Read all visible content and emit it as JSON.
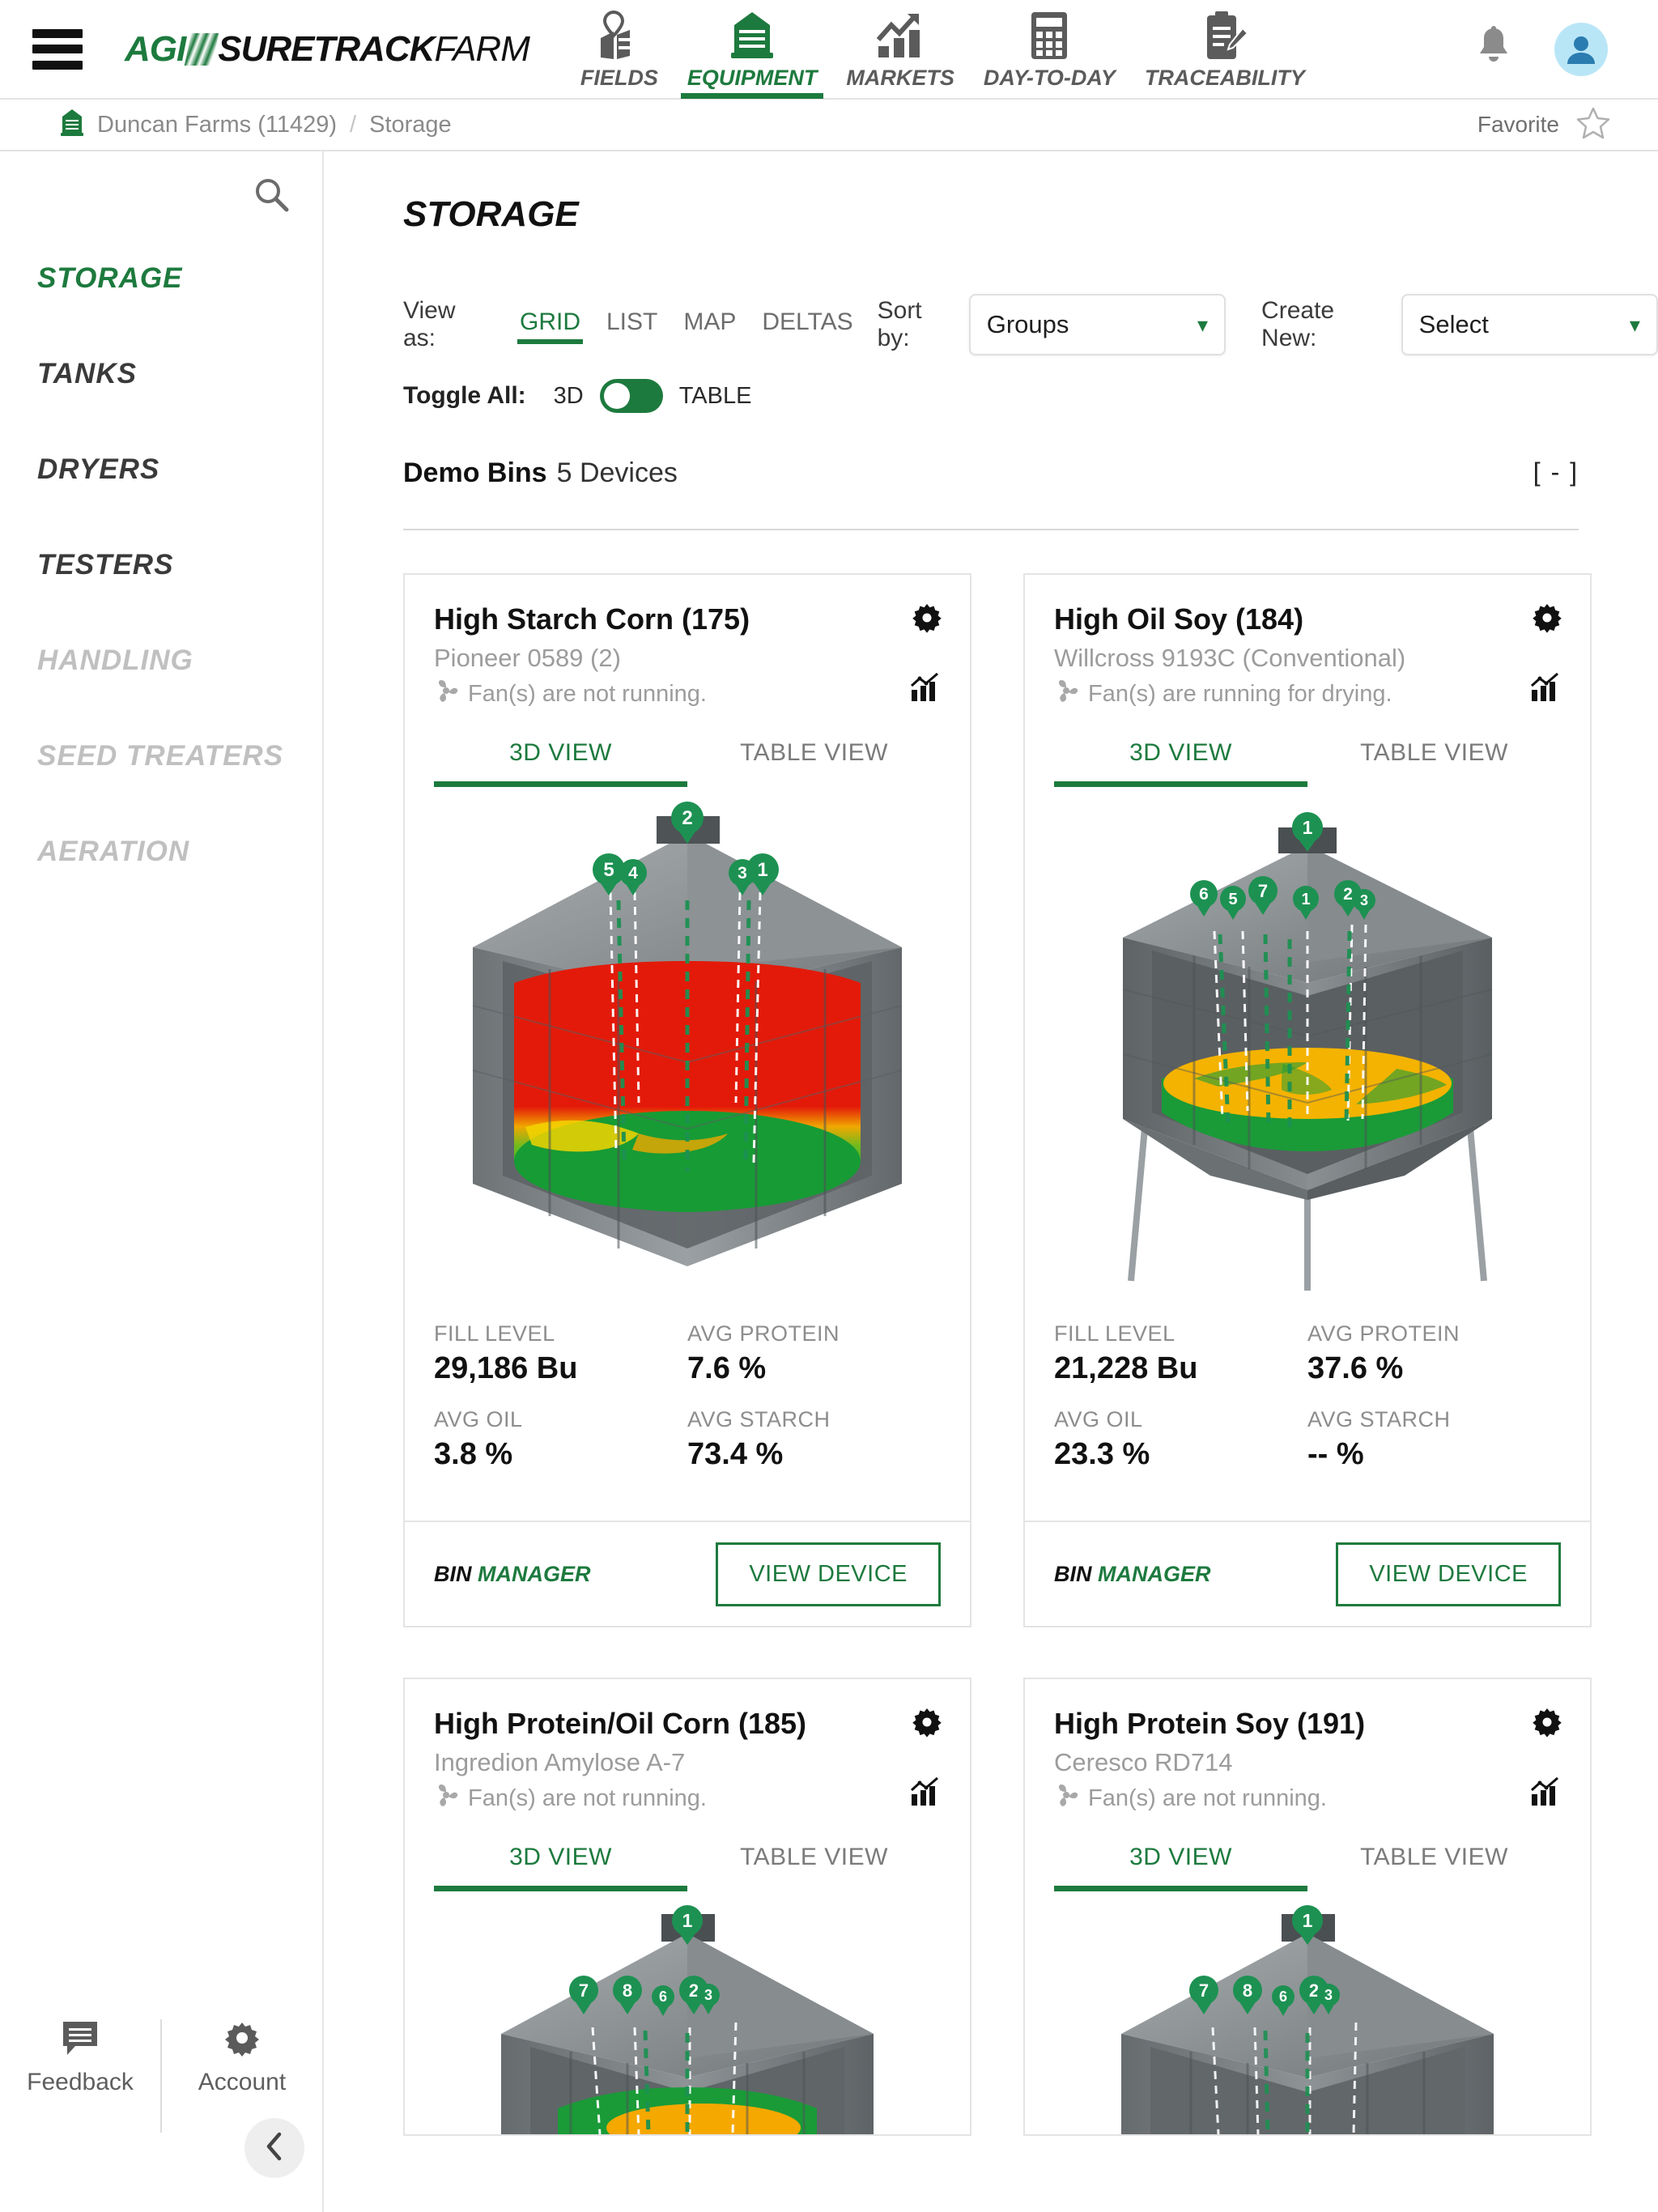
{
  "header": {
    "menu_icon": "hamburger-menu-icon",
    "brand": {
      "agi": "AGI",
      "sure": "SURETRACK",
      "farm": "FARM"
    },
    "nav": [
      {
        "label": "FIELDS",
        "icon": "map-pin-field-icon",
        "active": false
      },
      {
        "label": "EQUIPMENT",
        "icon": "grain-bin-icon",
        "active": true
      },
      {
        "label": "MARKETS",
        "icon": "bar-chart-trend-icon",
        "active": false
      },
      {
        "label": "DAY-TO-DAY",
        "icon": "calculator-icon",
        "active": false
      },
      {
        "label": "TRACEABILITY",
        "icon": "clipboard-pencil-icon",
        "active": false
      }
    ],
    "bell_icon": "notification-bell-icon",
    "avatar_icon": "user-avatar-icon"
  },
  "breadcrumb": {
    "farm_icon": "grain-bin-icon",
    "farm": "Duncan Farms (11429)",
    "separator": "/",
    "current": "Storage",
    "favorite_label": "Favorite",
    "favorite_icon": "star-outline-icon"
  },
  "sidebar": {
    "search_icon": "search-icon",
    "items": [
      {
        "label": "STORAGE",
        "state": "active"
      },
      {
        "label": "TANKS",
        "state": "normal"
      },
      {
        "label": "DRYERS",
        "state": "normal"
      },
      {
        "label": "TESTERS",
        "state": "normal"
      },
      {
        "label": "HANDLING",
        "state": "muted"
      },
      {
        "label": "SEED TREATERS",
        "state": "muted"
      },
      {
        "label": "AERATION",
        "state": "muted"
      }
    ],
    "footer": {
      "feedback_label": "Feedback",
      "feedback_icon": "comment-icon",
      "account_label": "Account",
      "account_icon": "gear-icon",
      "collapse_icon": "chevron-left-icon"
    }
  },
  "main": {
    "page_title": "STORAGE",
    "toolbar": {
      "view_as_label": "View as:",
      "view_options": [
        {
          "label": "GRID",
          "active": true
        },
        {
          "label": "LIST",
          "active": false
        },
        {
          "label": "MAP",
          "active": false
        },
        {
          "label": "DELTAS",
          "active": false
        }
      ],
      "sort_by_label": "Sort by:",
      "sort_by_value": "Groups",
      "create_new_label": "Create New:",
      "create_new_value": "Select",
      "chevron_icon": "chevron-down-icon"
    },
    "toggle_all": {
      "label": "Toggle All:",
      "left_option": "3D",
      "right_option": "TABLE",
      "state": "3D"
    },
    "group": {
      "name": "Demo Bins",
      "count": "5 Devices",
      "collapse_toggle": "[ - ]"
    },
    "tab_3d_label": "3D VIEW",
    "tab_table_label": "TABLE VIEW",
    "gear_icon": "gear-icon",
    "chart_icon": "bar-chart-icon",
    "fan_icon": "fan-icon",
    "bin_manager_bold": "BIN",
    "bin_manager_rest": " MANAGER",
    "view_device_label": "VIEW DEVICE",
    "stat_labels": {
      "fill_level": "FILL LEVEL",
      "avg_protein": "AVG PROTEIN",
      "avg_oil": "AVG OIL",
      "avg_starch": "AVG STARCH"
    },
    "cards": [
      {
        "title": "High Starch Corn (175)",
        "subtitle": "Pioneer 0589 (2)",
        "fan_status": "Fan(s) are not running.",
        "fill_level": "29,186 Bu",
        "avg_protein": "7.6 %",
        "avg_oil": "3.8 %",
        "avg_starch": "73.4 %",
        "bin_type": "hopper-flat",
        "fill_fraction": 0.78,
        "sensor_markers": [
          "5",
          "4",
          "2",
          "3",
          "1"
        ],
        "grain_colors": [
          "#e21b0c",
          "#f0a000",
          "#1ea33c"
        ]
      },
      {
        "title": "High Oil Soy (184)",
        "subtitle": "Willcross 9193C (Conventional)",
        "fan_status": "Fan(s) are running for drying.",
        "fill_level": "21,228 Bu",
        "avg_protein": "37.6 %",
        "avg_oil": "23.3 %",
        "avg_starch": "-- %",
        "bin_type": "legged-hopper",
        "fill_fraction": 0.35,
        "sensor_markers": [
          "6",
          "5",
          "7",
          "1",
          "1",
          "2",
          "3"
        ],
        "grain_colors": [
          "#f0b400",
          "#1ea33c"
        ]
      },
      {
        "title": "High Protein/Oil Corn (185)",
        "subtitle": "Ingredion Amylose A-7",
        "fan_status": "Fan(s) are not running.",
        "fill_level": "",
        "avg_protein": "",
        "avg_oil": "",
        "avg_starch": "",
        "bin_type": "flat",
        "fill_fraction": 0.3,
        "sensor_markers": [
          "1",
          "7",
          "8",
          "6",
          "2",
          "3"
        ],
        "grain_colors": [
          "#1ea33c",
          "#f5a800"
        ]
      },
      {
        "title": "High Protein Soy (191)",
        "subtitle": "Ceresco RD714",
        "fan_status": "Fan(s) are not running.",
        "fill_level": "",
        "avg_protein": "",
        "avg_oil": "",
        "avg_starch": "",
        "bin_type": "flat",
        "fill_fraction": 0.05,
        "sensor_markers": [
          "1",
          "7",
          "8",
          "6",
          "2",
          "3"
        ],
        "grain_colors": [
          "#1ea33c"
        ]
      }
    ]
  },
  "colors": {
    "brand_green": "#1d7a3e",
    "text_dark": "#111111",
    "text_muted": "#9c9c9c",
    "avatar_bg": "#b9e6f7"
  }
}
